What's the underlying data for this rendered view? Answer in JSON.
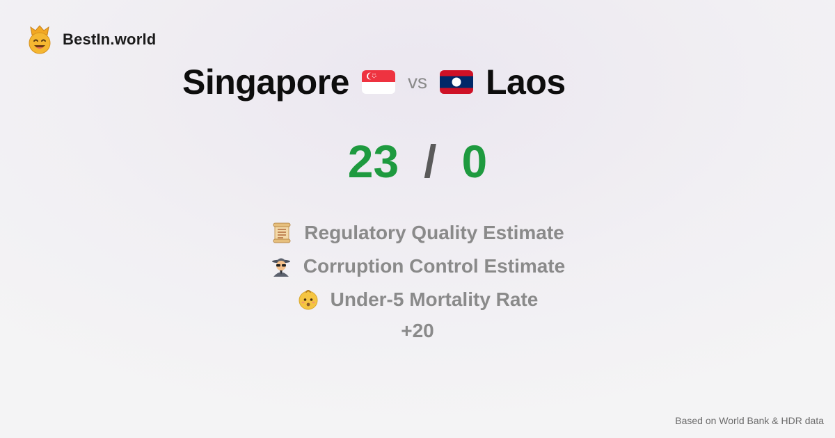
{
  "brand": {
    "name": "BestIn.world",
    "logo_icon": "crown-smiley-icon"
  },
  "comparison": {
    "left_country": "Singapore",
    "left_flag_icon": "singapore-flag-icon",
    "vs_label": "vs",
    "right_country": "Laos",
    "right_flag_icon": "laos-flag-icon"
  },
  "score": {
    "left": "23",
    "separator": "/",
    "right": "0",
    "color": "#1e9a3f"
  },
  "metrics": [
    {
      "label": "Regulatory Quality Estimate",
      "icon": "scroll-icon"
    },
    {
      "label": "Corruption Control Estimate",
      "icon": "spy-icon"
    },
    {
      "label": "Under-5 Mortality Rate",
      "icon": "baby-icon"
    }
  ],
  "more_label": "+20",
  "footer": {
    "source": "Based on World Bank & HDR data"
  }
}
